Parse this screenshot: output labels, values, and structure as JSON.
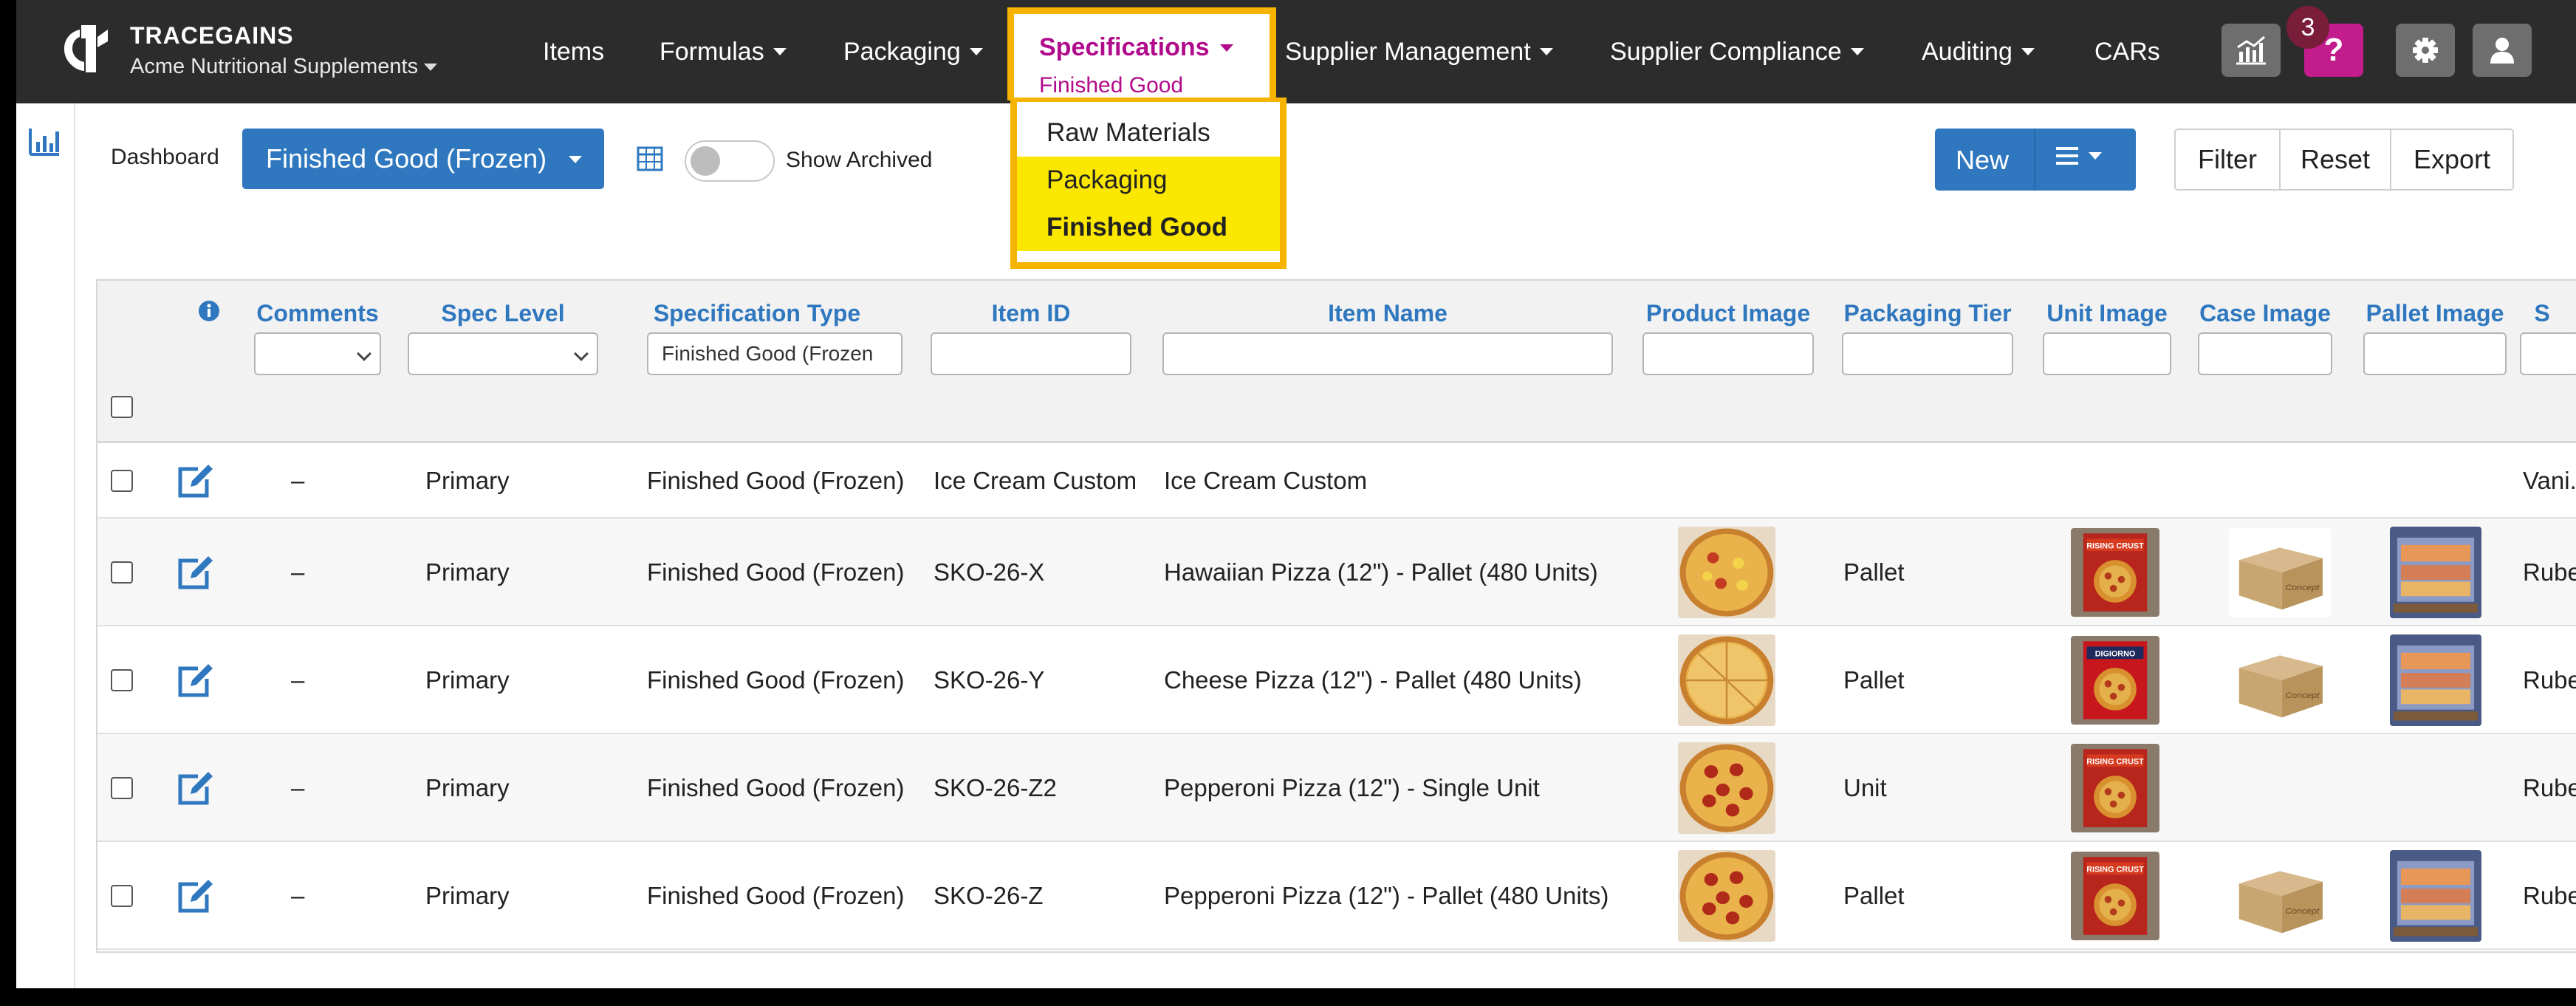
{
  "brand": {
    "name": "TRACEGAINS",
    "org": "Acme Nutritional Supplements"
  },
  "nav": {
    "items": [
      "Items",
      "Formulas",
      "Packaging",
      "Supplier Management",
      "Supplier Compliance",
      "Auditing",
      "CARs"
    ],
    "specifications": {
      "label": "Specifications",
      "sub": "Finished Good"
    },
    "notification_count": "3",
    "help_symbol": "?"
  },
  "spec_menu": {
    "items": [
      "Raw Materials",
      "Packaging",
      "Finished Good"
    ],
    "highlighted": [
      "Packaging",
      "Finished Good"
    ],
    "active": "Finished Good"
  },
  "toolbar": {
    "dashboard_label": "Dashboard",
    "view_select": "Finished Good (Frozen)",
    "show_archived_label": "Show Archived",
    "show_archived": false,
    "new_label": "New",
    "filter_label": "Filter",
    "reset_label": "Reset",
    "export_label": "Export"
  },
  "table": {
    "columns": [
      "Comments",
      "Spec Level",
      "Specification Type",
      "Item ID",
      "Item Name",
      "Product Image",
      "Packaging Tier",
      "Unit Image",
      "Case Image",
      "Pallet Image",
      "S"
    ],
    "filter_values": {
      "specification_type": "Finished Good (Frozen"
    },
    "rows": [
      {
        "comments": "–",
        "spec_level": "Primary",
        "spec_type": "Finished Good (Frozen)",
        "item_id": "Ice Cream Custom",
        "item_name": "Ice Cream Custom",
        "tier": "",
        "last": "Vani...",
        "images": {
          "product": "",
          "unit": "",
          "case": "",
          "pallet": ""
        }
      },
      {
        "comments": "–",
        "spec_level": "Primary",
        "spec_type": "Finished Good (Frozen)",
        "item_id": "SKO-26-X",
        "item_name": "Hawaiian Pizza (12\") - Pallet (480 Units)",
        "tier": "Pallet",
        "last": "Rube",
        "images": {
          "product": "hawaiian-pizza",
          "unit": "pizza-box-rising-crust",
          "case": "cardboard-case",
          "pallet": "pallet-wrapped"
        }
      },
      {
        "comments": "–",
        "spec_level": "Primary",
        "spec_type": "Finished Good (Frozen)",
        "item_id": "SKO-26-Y",
        "item_name": "Cheese Pizza (12\") - Pallet (480 Units)",
        "tier": "Pallet",
        "last": "Rube",
        "images": {
          "product": "cheese-pizza",
          "unit": "pizza-box-digiorno",
          "case": "cardboard-case",
          "pallet": "pallet-wrapped"
        }
      },
      {
        "comments": "–",
        "spec_level": "Primary",
        "spec_type": "Finished Good (Frozen)",
        "item_id": "SKO-26-Z2",
        "item_name": "Pepperoni Pizza (12\") - Single Unit",
        "tier": "Unit",
        "last": "Rube",
        "images": {
          "product": "pepperoni-pizza",
          "unit": "pizza-box-rising-crust",
          "case": "",
          "pallet": ""
        }
      },
      {
        "comments": "–",
        "spec_level": "Primary",
        "spec_type": "Finished Good (Frozen)",
        "item_id": "SKO-26-Z",
        "item_name": "Pepperoni Pizza (12\") - Pallet (480 Units)",
        "tier": "Pallet",
        "last": "Rube",
        "images": {
          "product": "pepperoni-pizza",
          "unit": "pizza-box-rising-crust",
          "case": "cardboard-case",
          "pallet": "pallet-wrapped"
        }
      }
    ]
  },
  "case_box_text": "Concept",
  "box_brands": {
    "rising": "RISING CRUST",
    "digiorno": "DIGIORNO"
  },
  "colors": {
    "nav_bg": "#2c2c2c",
    "accent": "#2f78bf",
    "spec_magenta": "#b10a8b",
    "highlight_border": "#f6b400",
    "highlight_fill": "#fbe700",
    "help_bg": "#c21c8d",
    "badge_bg": "#7a1d3a"
  }
}
